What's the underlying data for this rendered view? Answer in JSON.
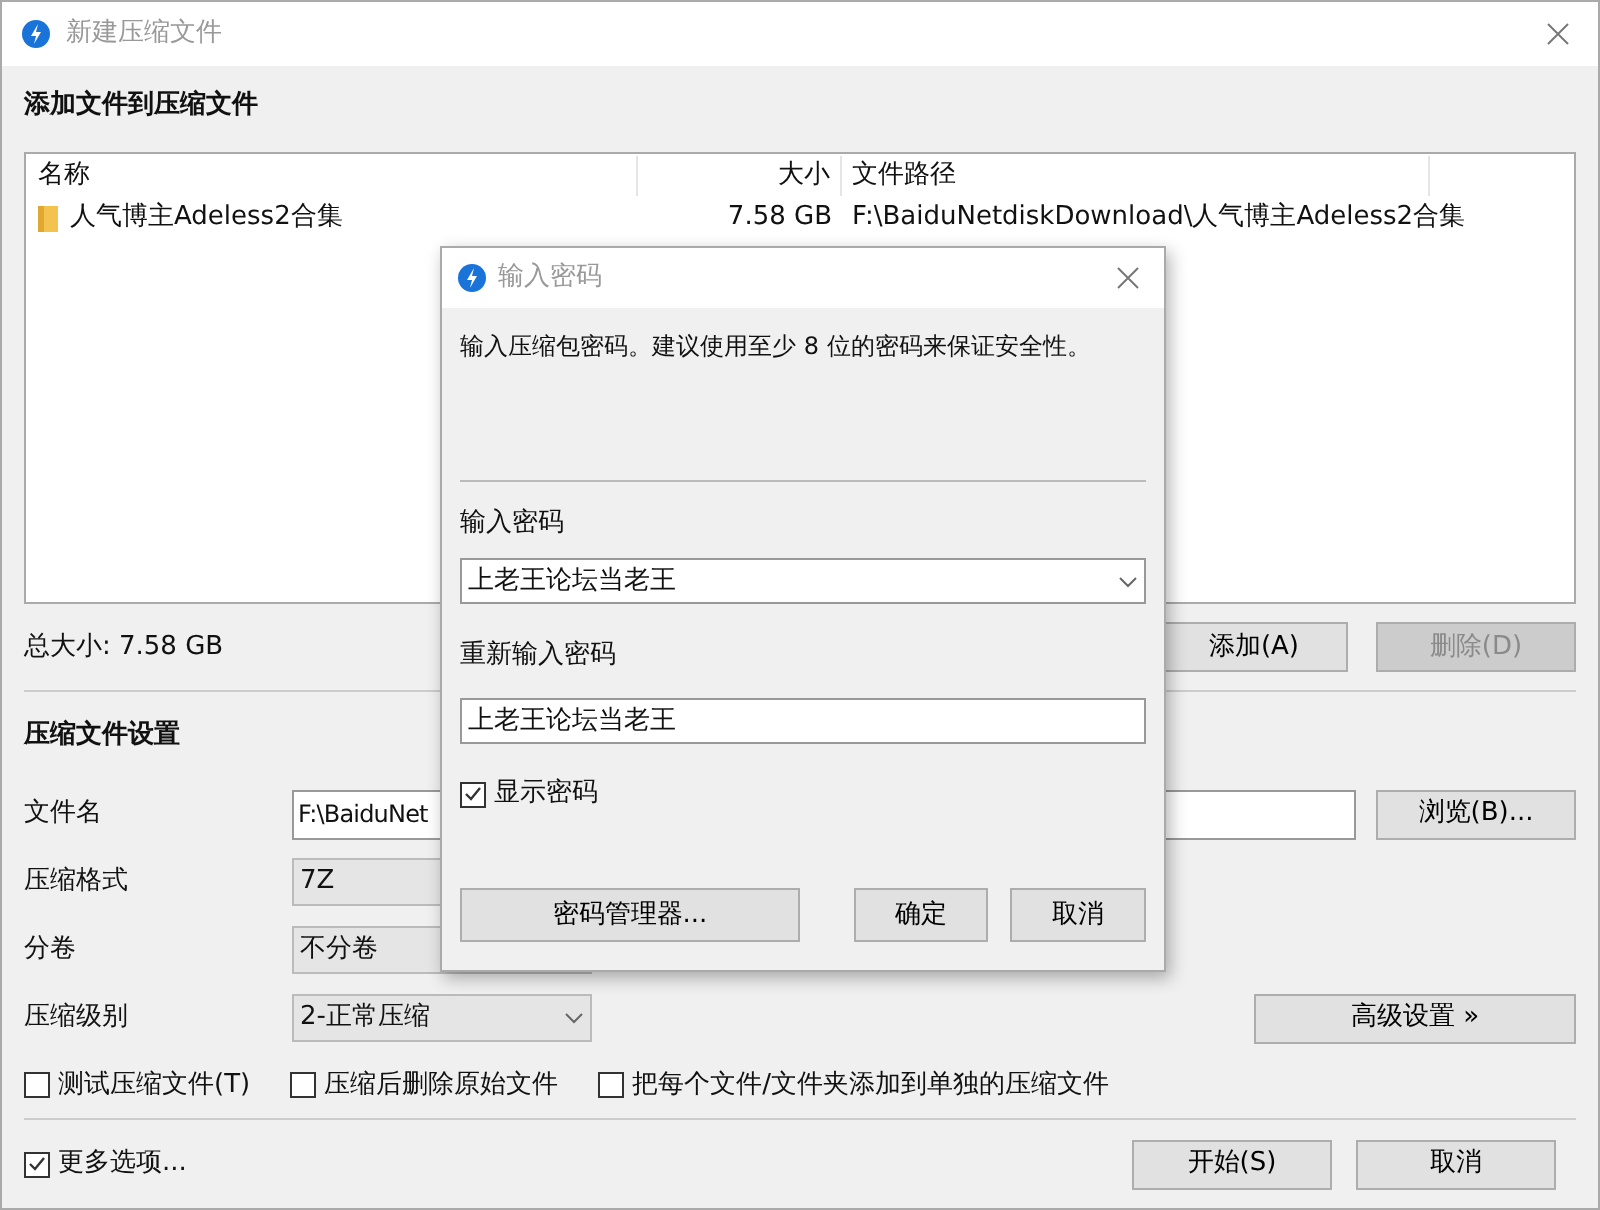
{
  "window": {
    "title": "新建压缩文件"
  },
  "files_section": {
    "title": "添加文件到压缩文件",
    "columns": [
      "名称",
      "大小",
      "文件路径"
    ],
    "rows": [
      {
        "name": "人气博主Adeless2合集",
        "size": "7.58 GB",
        "path": "F:\\BaiduNetdiskDownload\\人气博主Adeless2合集"
      }
    ],
    "total": "总大小: 7.58 GB",
    "add_button": {
      "label": "添加(A)",
      "disabled": false
    },
    "delete_button": {
      "label": "删除(D)",
      "disabled": true
    }
  },
  "settings": {
    "title": "压缩文件设置",
    "fields": [
      {
        "kind": "text",
        "label": "文件名",
        "value": "F:\\BaiduNet",
        "button": "浏览(B)..."
      },
      {
        "kind": "select",
        "label": "压缩格式",
        "value": "7Z"
      },
      {
        "kind": "select",
        "label": "分卷",
        "value": "不分卷"
      },
      {
        "kind": "select",
        "label": "压缩级别",
        "value": "2-正常压缩",
        "button": "高级设置 »"
      }
    ],
    "options": [
      {
        "label": "测试压缩文件(T)",
        "checked": false
      },
      {
        "label": "压缩后删除原始文件",
        "checked": false
      },
      {
        "label": "把每个文件/文件夹添加到单独的压缩文件",
        "checked": false
      }
    ]
  },
  "footer": {
    "more": {
      "label": "更多选项...",
      "checked": true
    },
    "buttons": [
      "开始(S)",
      "取消"
    ]
  },
  "dialog": {
    "title": "输入密码",
    "message": "输入压缩包密码。建议使用至少 8 位的密码来保证安全性。",
    "password_label": "输入密码",
    "password": "上老王论坛当老王",
    "confirm_label": "重新输入密码",
    "confirm": "上老王论坛当老王",
    "show_password": {
      "label": "显示密码",
      "checked": true
    },
    "buttons": [
      "密码管理器...",
      "确定",
      "取消"
    ]
  }
}
